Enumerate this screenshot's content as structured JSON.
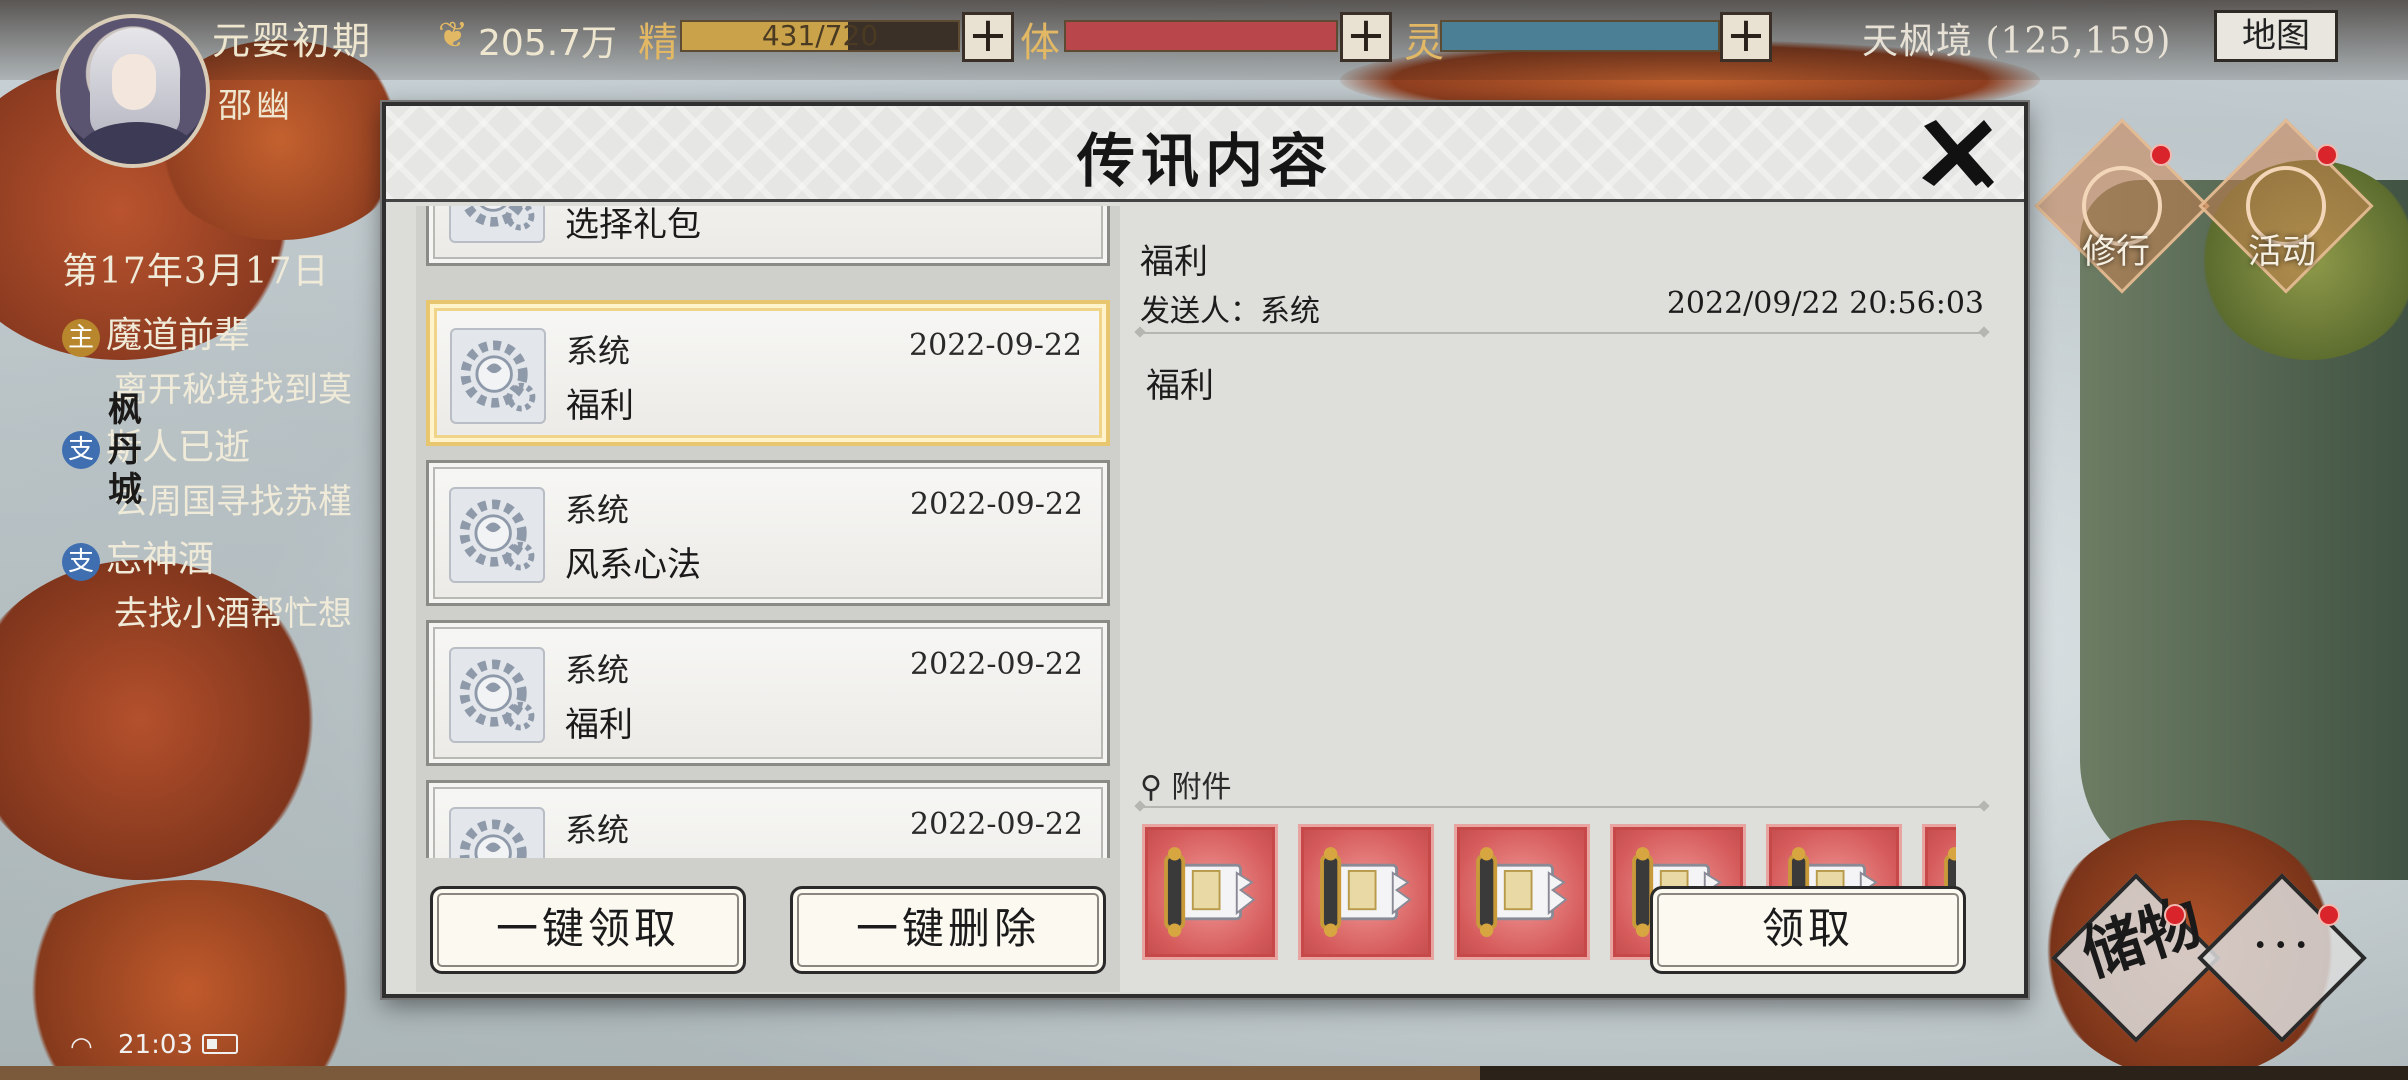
{
  "hud": {
    "rank": "元婴初期",
    "player_name": "邵幽",
    "coin_icon": "spirit-coin-icon",
    "coin_value": "205.7万",
    "stats": [
      {
        "label": "精",
        "value_text": "431/720",
        "fraction": 0.6,
        "color": "#c9a24a"
      },
      {
        "label": "体",
        "value_text": "",
        "fraction": 1.0,
        "color": "#b8464a"
      },
      {
        "label": "灵",
        "value_text": "",
        "fraction": 1.0,
        "color": "#4b7f96"
      }
    ],
    "location": "天枫境 (125,159)",
    "map_button": "地图"
  },
  "quests": {
    "date": "第17年3月17日",
    "items": [
      {
        "tag": "主",
        "tag_color": "#b8862c",
        "title": "魔道前辈",
        "desc": "离开秘境找到莫"
      },
      {
        "tag": "支",
        "tag_color": "#3f6fb0",
        "title": "斯人已逝",
        "desc": "去周国寻找苏槿"
      },
      {
        "tag": "支",
        "tag_color": "#3f6fb0",
        "title": "忘神酒",
        "desc": "去找小酒帮忙想"
      }
    ],
    "city_label": "枫丹城"
  },
  "side_buttons": {
    "cultivate": "修行",
    "activity": "活动",
    "storage": "储物",
    "more": "···"
  },
  "status_bar": {
    "time": "21:03"
  },
  "modal": {
    "title": "传讯内容",
    "messages": [
      {
        "sender": "",
        "date": "",
        "subject": "选择礼包",
        "selected": false
      },
      {
        "sender": "系统",
        "date": "2022-09-22",
        "subject": "福利",
        "selected": true
      },
      {
        "sender": "系统",
        "date": "2022-09-22",
        "subject": "风系心法",
        "selected": false
      },
      {
        "sender": "系统",
        "date": "2022-09-22",
        "subject": "福利",
        "selected": false
      },
      {
        "sender": "系统",
        "date": "2022-09-22",
        "subject": "",
        "selected": false
      }
    ],
    "claim_all_button": "一键领取",
    "delete_all_button": "一键删除",
    "detail": {
      "title": "福利",
      "sender_line": "发送人：系统",
      "timestamp": "2022/09/22 20:56:03",
      "body": "福利",
      "attachments_label": "附件",
      "attachment_icon": "scroll-icon",
      "attachment_count_visible": 6,
      "claim_button": "领取"
    }
  }
}
